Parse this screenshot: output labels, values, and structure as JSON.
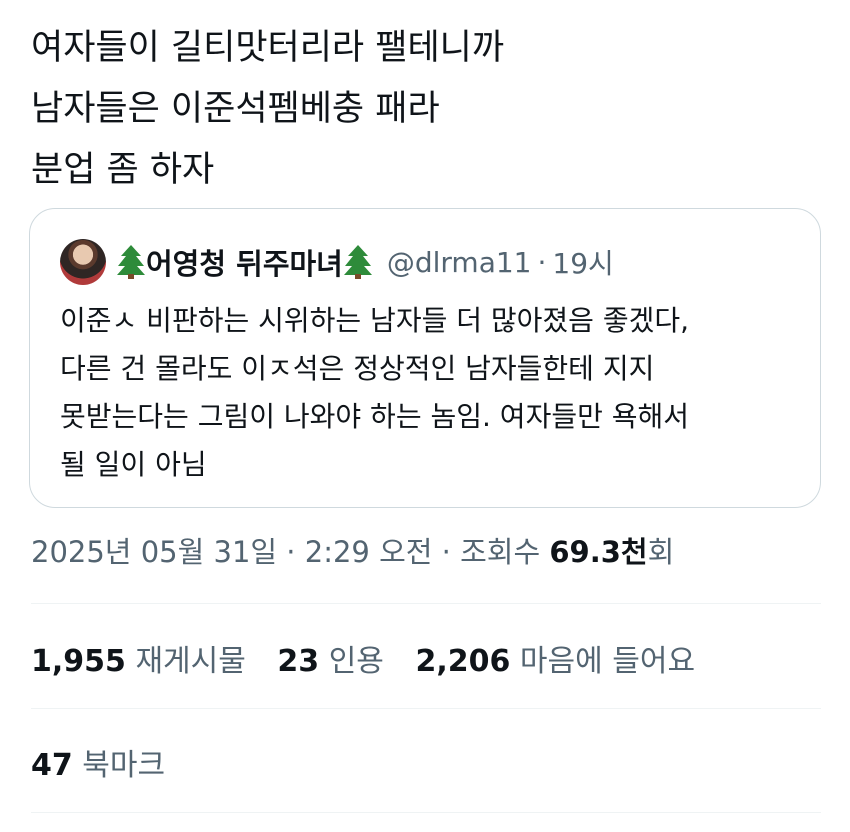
{
  "tweet": {
    "lines": [
      "여자들이 길티맛터리라 팰테니까",
      "남자들은 이준석펨베충 패라",
      "분업 좀 하자"
    ]
  },
  "quote": {
    "name": "어영청 뒤주마녀",
    "name_emoji": "tree-emoji-icon",
    "handle": "@dlrma11",
    "separator": "·",
    "time": "19시",
    "body_lines": [
      "이준ㅅ 비판하는 시위하는 남자들 더 많아졌음 좋겠다,",
      "다른 건 몰라도 이ㅈ석은 정상적인 남자들한테 지지",
      "못받는다는 그림이 나와야 하는 놈임. 여자들만 욕해서",
      "될 일이 아님"
    ]
  },
  "meta": {
    "datetime": "2025년 05월 31일 · 2:29 오전 · 조회수 ",
    "views_number": "69.3천",
    "views_suffix": "회"
  },
  "stats": {
    "retweets_count": "1,955",
    "retweets_label": "재게시물",
    "quotes_count": "23",
    "quotes_label": "인용",
    "likes_count": "2,206",
    "likes_label": "마음에 들어요"
  },
  "bookmarks": {
    "count": "47",
    "label": "북마크"
  },
  "colors": {
    "text_primary": "#0f1419",
    "text_secondary": "#536471",
    "border": "#cfd9de",
    "divider": "#eff3f4",
    "tree_green": "#2e8b3a"
  }
}
